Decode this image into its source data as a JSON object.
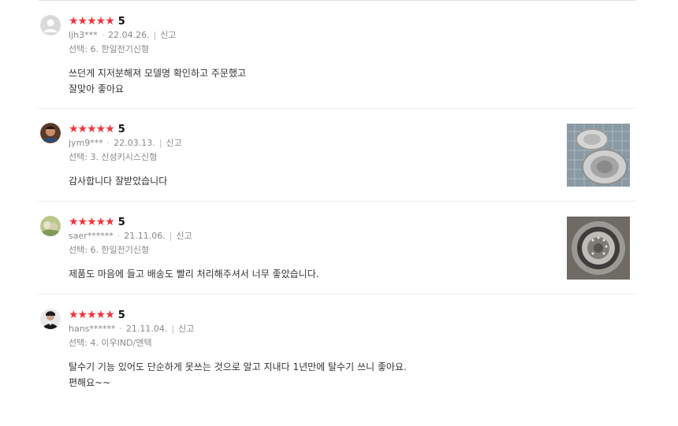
{
  "reviews": [
    {
      "stars": "★★★★★",
      "score": "5",
      "user": "ljh3***",
      "date": "22.04.26.",
      "report": "신고",
      "option": "선택: 6. 한일전기신형",
      "text": "쓰던게 지저분해져 모델명 확인하고 주문했고\n잘맞아 좋아요"
    },
    {
      "stars": "★★★★★",
      "score": "5",
      "user": "jym9***",
      "date": "22.03.13.",
      "report": "신고",
      "option": "선택: 3. 신성키시스신형",
      "text": "감사합니다 잘받았습니다"
    },
    {
      "stars": "★★★★★",
      "score": "5",
      "user": "saer******",
      "date": "21.11.06.",
      "report": "신고",
      "option": "선택: 6. 한일전기신형",
      "text": "제품도 마음에 들고 배송도 빨리 처리해주셔서 너무 좋았습니다."
    },
    {
      "stars": "★★★★★",
      "score": "5",
      "user": "hans******",
      "date": "21.11.04.",
      "report": "신고",
      "option": "선택: 4. 이우IND/엔텍",
      "text": "탈수기 기능 있어도 단순하게 못쓰는 것으로 알고 지내다 1년만에 탈수기 쓰니 좋아요.\n편해요~~"
    }
  ],
  "colors": {
    "star": "#f0353b",
    "meta": "#888888",
    "divider": "#ececec"
  }
}
